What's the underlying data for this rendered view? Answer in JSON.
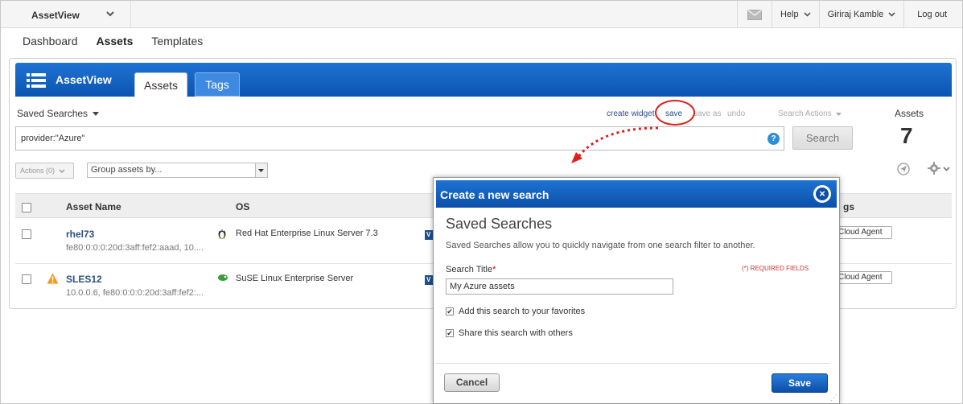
{
  "topbar": {
    "app_name": "AssetView",
    "help_label": "Help",
    "user_name": "Giriraj Kamble",
    "logout_label": "Log out"
  },
  "nav": {
    "items": [
      {
        "label": "Dashboard",
        "active": false
      },
      {
        "label": "Assets",
        "active": true
      },
      {
        "label": "Templates",
        "active": false
      }
    ]
  },
  "panel": {
    "title": "AssetView",
    "tabs": [
      {
        "label": "Assets",
        "active": true
      },
      {
        "label": "Tags",
        "active": false
      }
    ],
    "saved_searches_label": "Saved Searches",
    "toolbar": {
      "create_widget": "create widget",
      "save": "save",
      "save_as": "save as",
      "undo": "undo",
      "search_actions": "Search Actions"
    },
    "assets_label": "Assets",
    "assets_count": "7",
    "search": {
      "value": "provider:\"Azure\"",
      "button": "Search"
    },
    "actions_dropdown": "Actions (0)",
    "group_by_placeholder": "Group assets by...",
    "table": {
      "headers": {
        "asset_name": "Asset Name",
        "os": "OS",
        "tags": "gs"
      },
      "rows": [
        {
          "name": "rhel73",
          "sub": "fe80:0:0:0:20d:3aff:fef2:aaad, 10....",
          "os": "Red Hat Enterprise Linux Server 7.3",
          "os_icon": "linux-tux-icon",
          "tag": "Cloud Agent",
          "warning": false
        },
        {
          "name": "SLES12",
          "sub": "10.0.0.6, fe80:0:0:0:20d:3aff:fef2:...",
          "os": "SuSE Linux Enterprise Server",
          "os_icon": "suse-icon",
          "tag": "Cloud Agent",
          "warning": true
        }
      ]
    }
  },
  "modal": {
    "header_title": "Create a new search",
    "section_title": "Saved Searches",
    "description": "Saved Searches allow you to quickly navigate from one search filter to another.",
    "field_label": "Search Title",
    "required_marker": "*",
    "required_note": "(*) REQUIRED FIELDS",
    "field_value": "My Azure assets",
    "checkboxes": [
      {
        "label": "Add this search to your favorites",
        "checked": true
      },
      {
        "label": "Share this search with others",
        "checked": true
      }
    ],
    "cancel_label": "Cancel",
    "save_label": "Save"
  },
  "colors": {
    "brand_blue": "#0c54b0",
    "link_blue": "#2c4f85",
    "highlight_red": "#e0201b"
  }
}
